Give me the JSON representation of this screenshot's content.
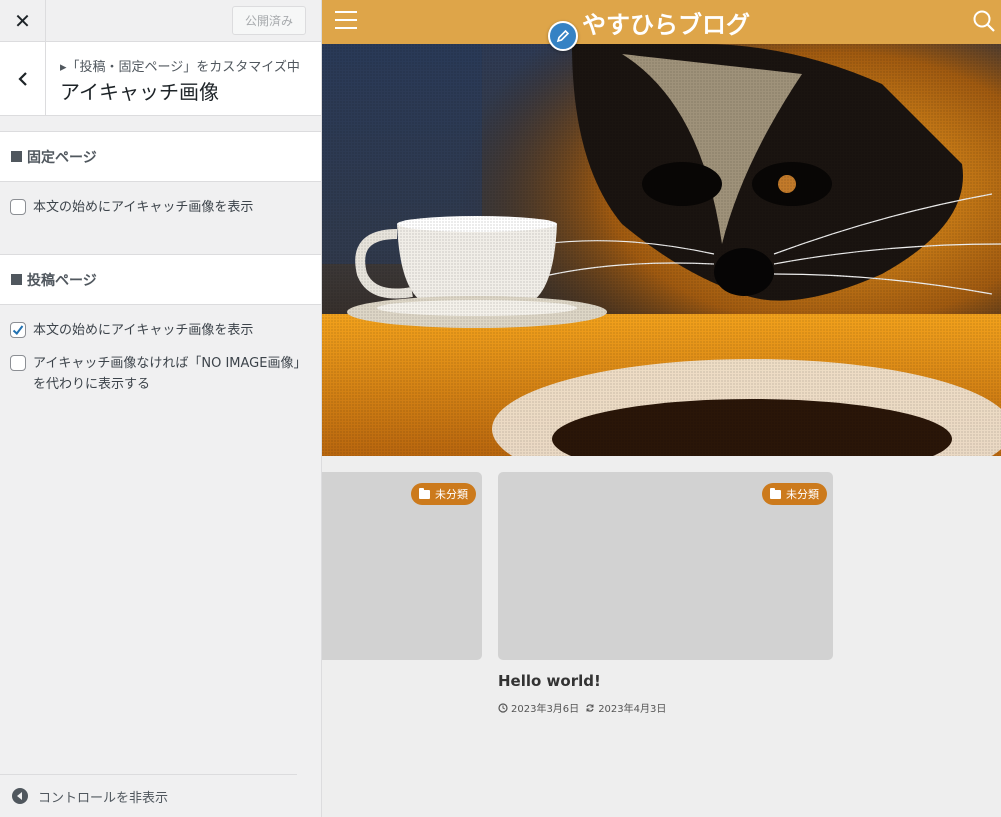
{
  "sidebar": {
    "close_icon": "close-icon",
    "publish_label": "公開済み",
    "breadcrumb": "▸「投稿・固定ページ」をカスタマイズ中",
    "panel_title": "アイキャッチ画像",
    "sections": [
      {
        "heading": "固定ページ",
        "options": [
          {
            "label": "本文の始めにアイキャッチ画像を表示",
            "checked": false
          }
        ]
      },
      {
        "heading": "投稿ページ",
        "options": [
          {
            "label": "本文の始めにアイキャッチ画像を表示",
            "checked": true
          },
          {
            "label_line1": "アイキャッチ画像なければ「NO IMAGE画像」",
            "label_line2": "を代わりに表示する",
            "checked": false
          }
        ]
      }
    ],
    "hide_controls_label": "コントロールを非表示"
  },
  "preview": {
    "site_title": "やすひらブログ",
    "header_color": "#dea549",
    "accent_color": "#cc7a1c",
    "cards": [
      {
        "category": "未分類"
      },
      {
        "category": "未分類",
        "title": "Hello world!",
        "published": "2023年3月6日",
        "updated": "2023年4月3日"
      }
    ]
  }
}
